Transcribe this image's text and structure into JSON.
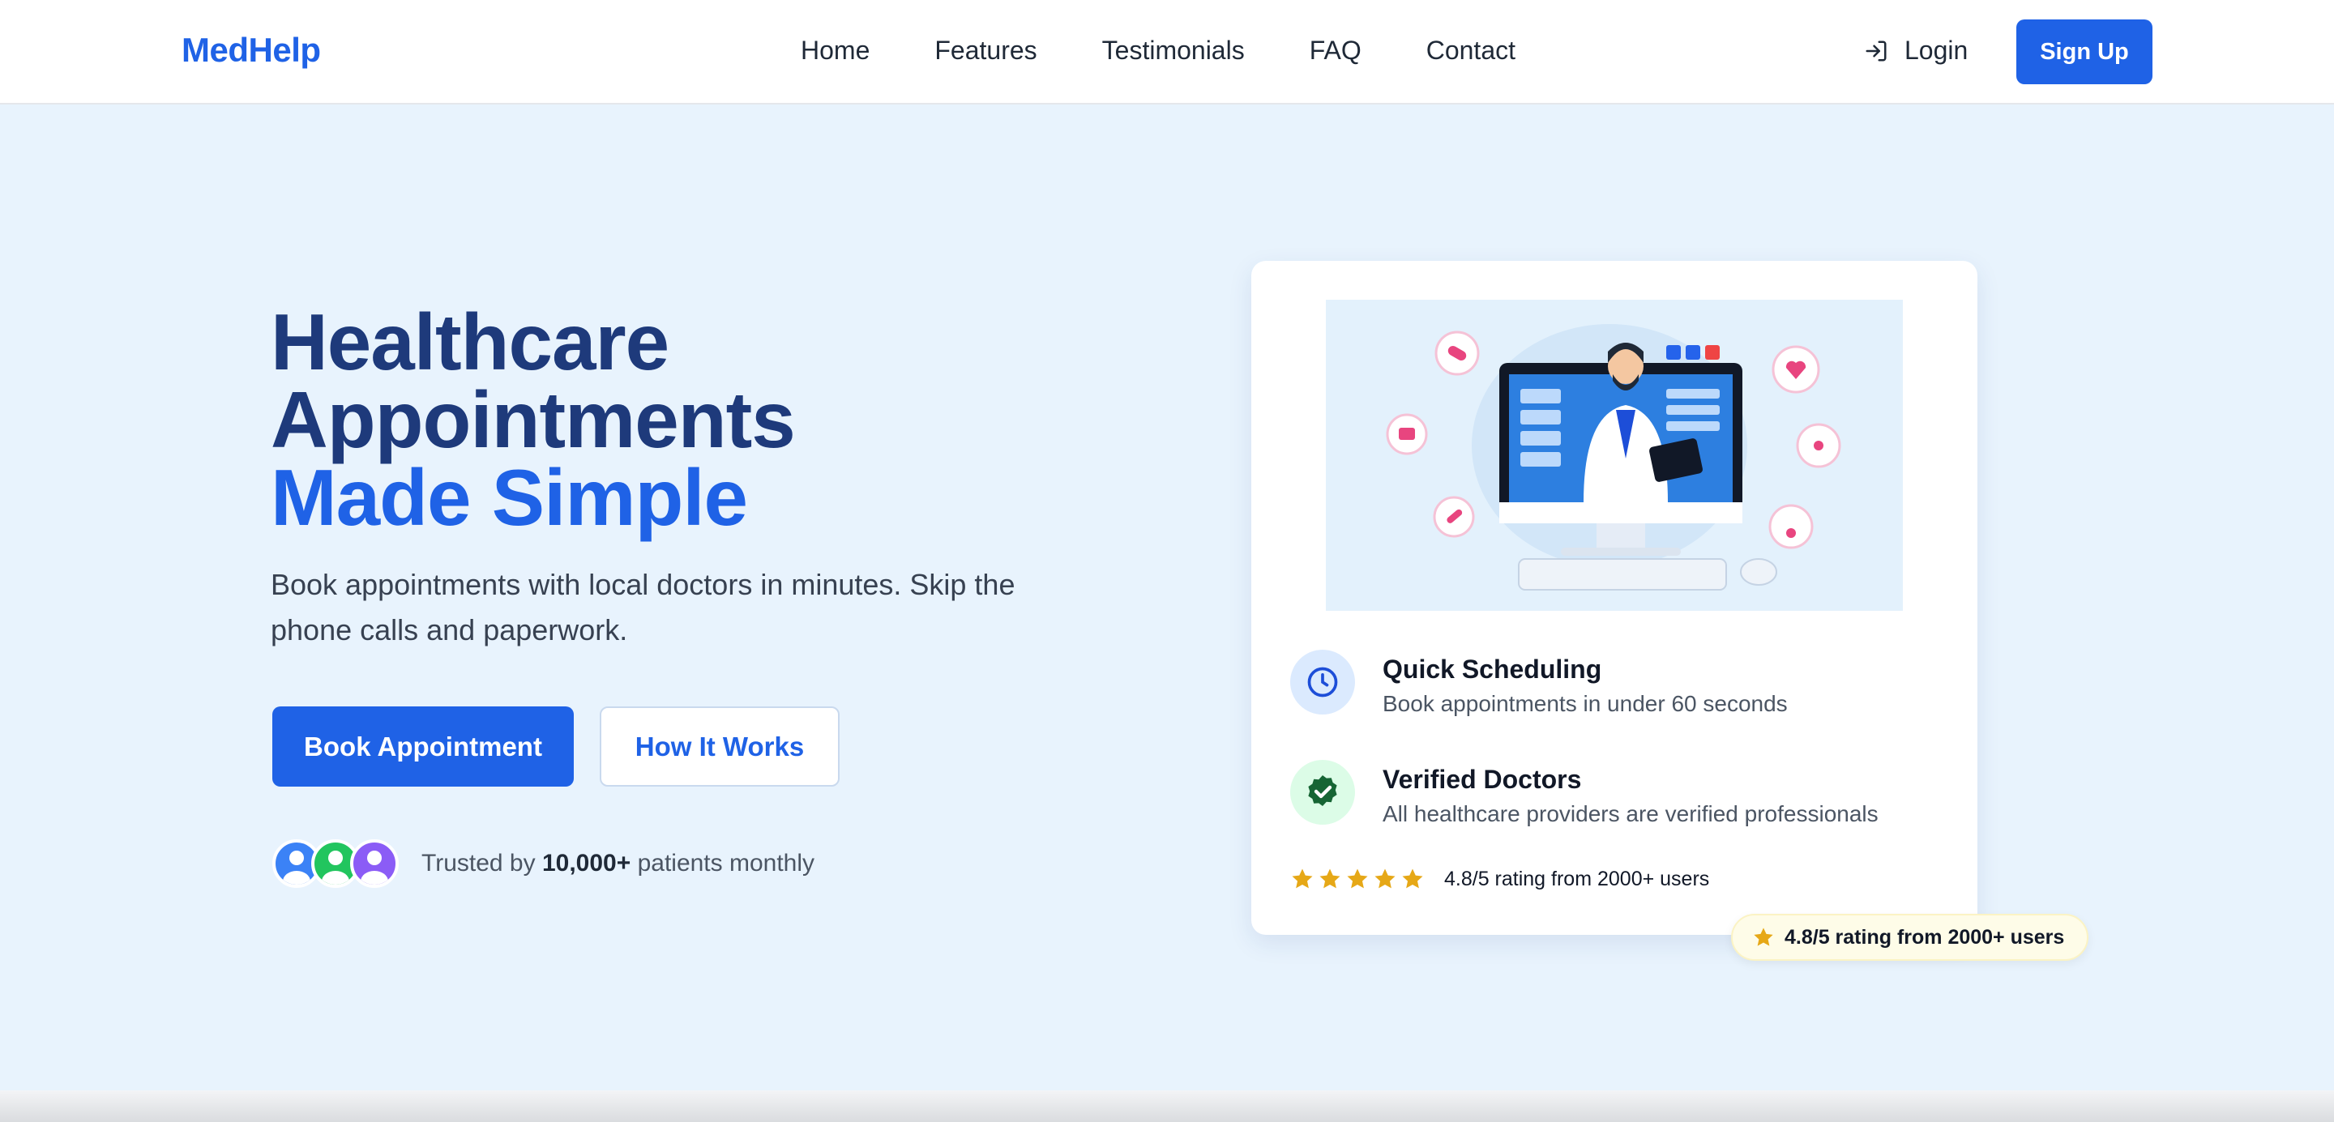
{
  "brand": {
    "name": "MedHelp",
    "accent": "#1f62e6"
  },
  "nav": {
    "links": [
      "Home",
      "Features",
      "Testimonials",
      "FAQ",
      "Contact"
    ],
    "login_label": "Login",
    "signup_label": "Sign Up"
  },
  "hero": {
    "title_line1": "Healthcare",
    "title_line2": "Appointments",
    "title_accent": "Made Simple",
    "subtitle": "Book appointments with local doctors in minutes. Skip the phone calls and paperwork.",
    "primary_cta": "Book Appointment",
    "secondary_cta": "How It Works",
    "trust_prefix": "Trusted by ",
    "trust_count": "10,000+",
    "trust_suffix": " patients monthly",
    "avatar_colors": [
      "#3b82f6",
      "#22c55e",
      "#8b5cf6"
    ]
  },
  "card": {
    "features": [
      {
        "icon": "clock-icon",
        "title": "Quick Scheduling",
        "desc": "Book appointments in under 60 seconds"
      },
      {
        "icon": "verified-badge-icon",
        "title": "Verified Doctors",
        "desc": "All healthcare providers are verified professionals"
      }
    ],
    "rating_stars": 5,
    "rating_text": "4.8/5 rating from 2000+ users"
  },
  "badge": {
    "text": "4.8/5 rating from 2000+ users"
  }
}
